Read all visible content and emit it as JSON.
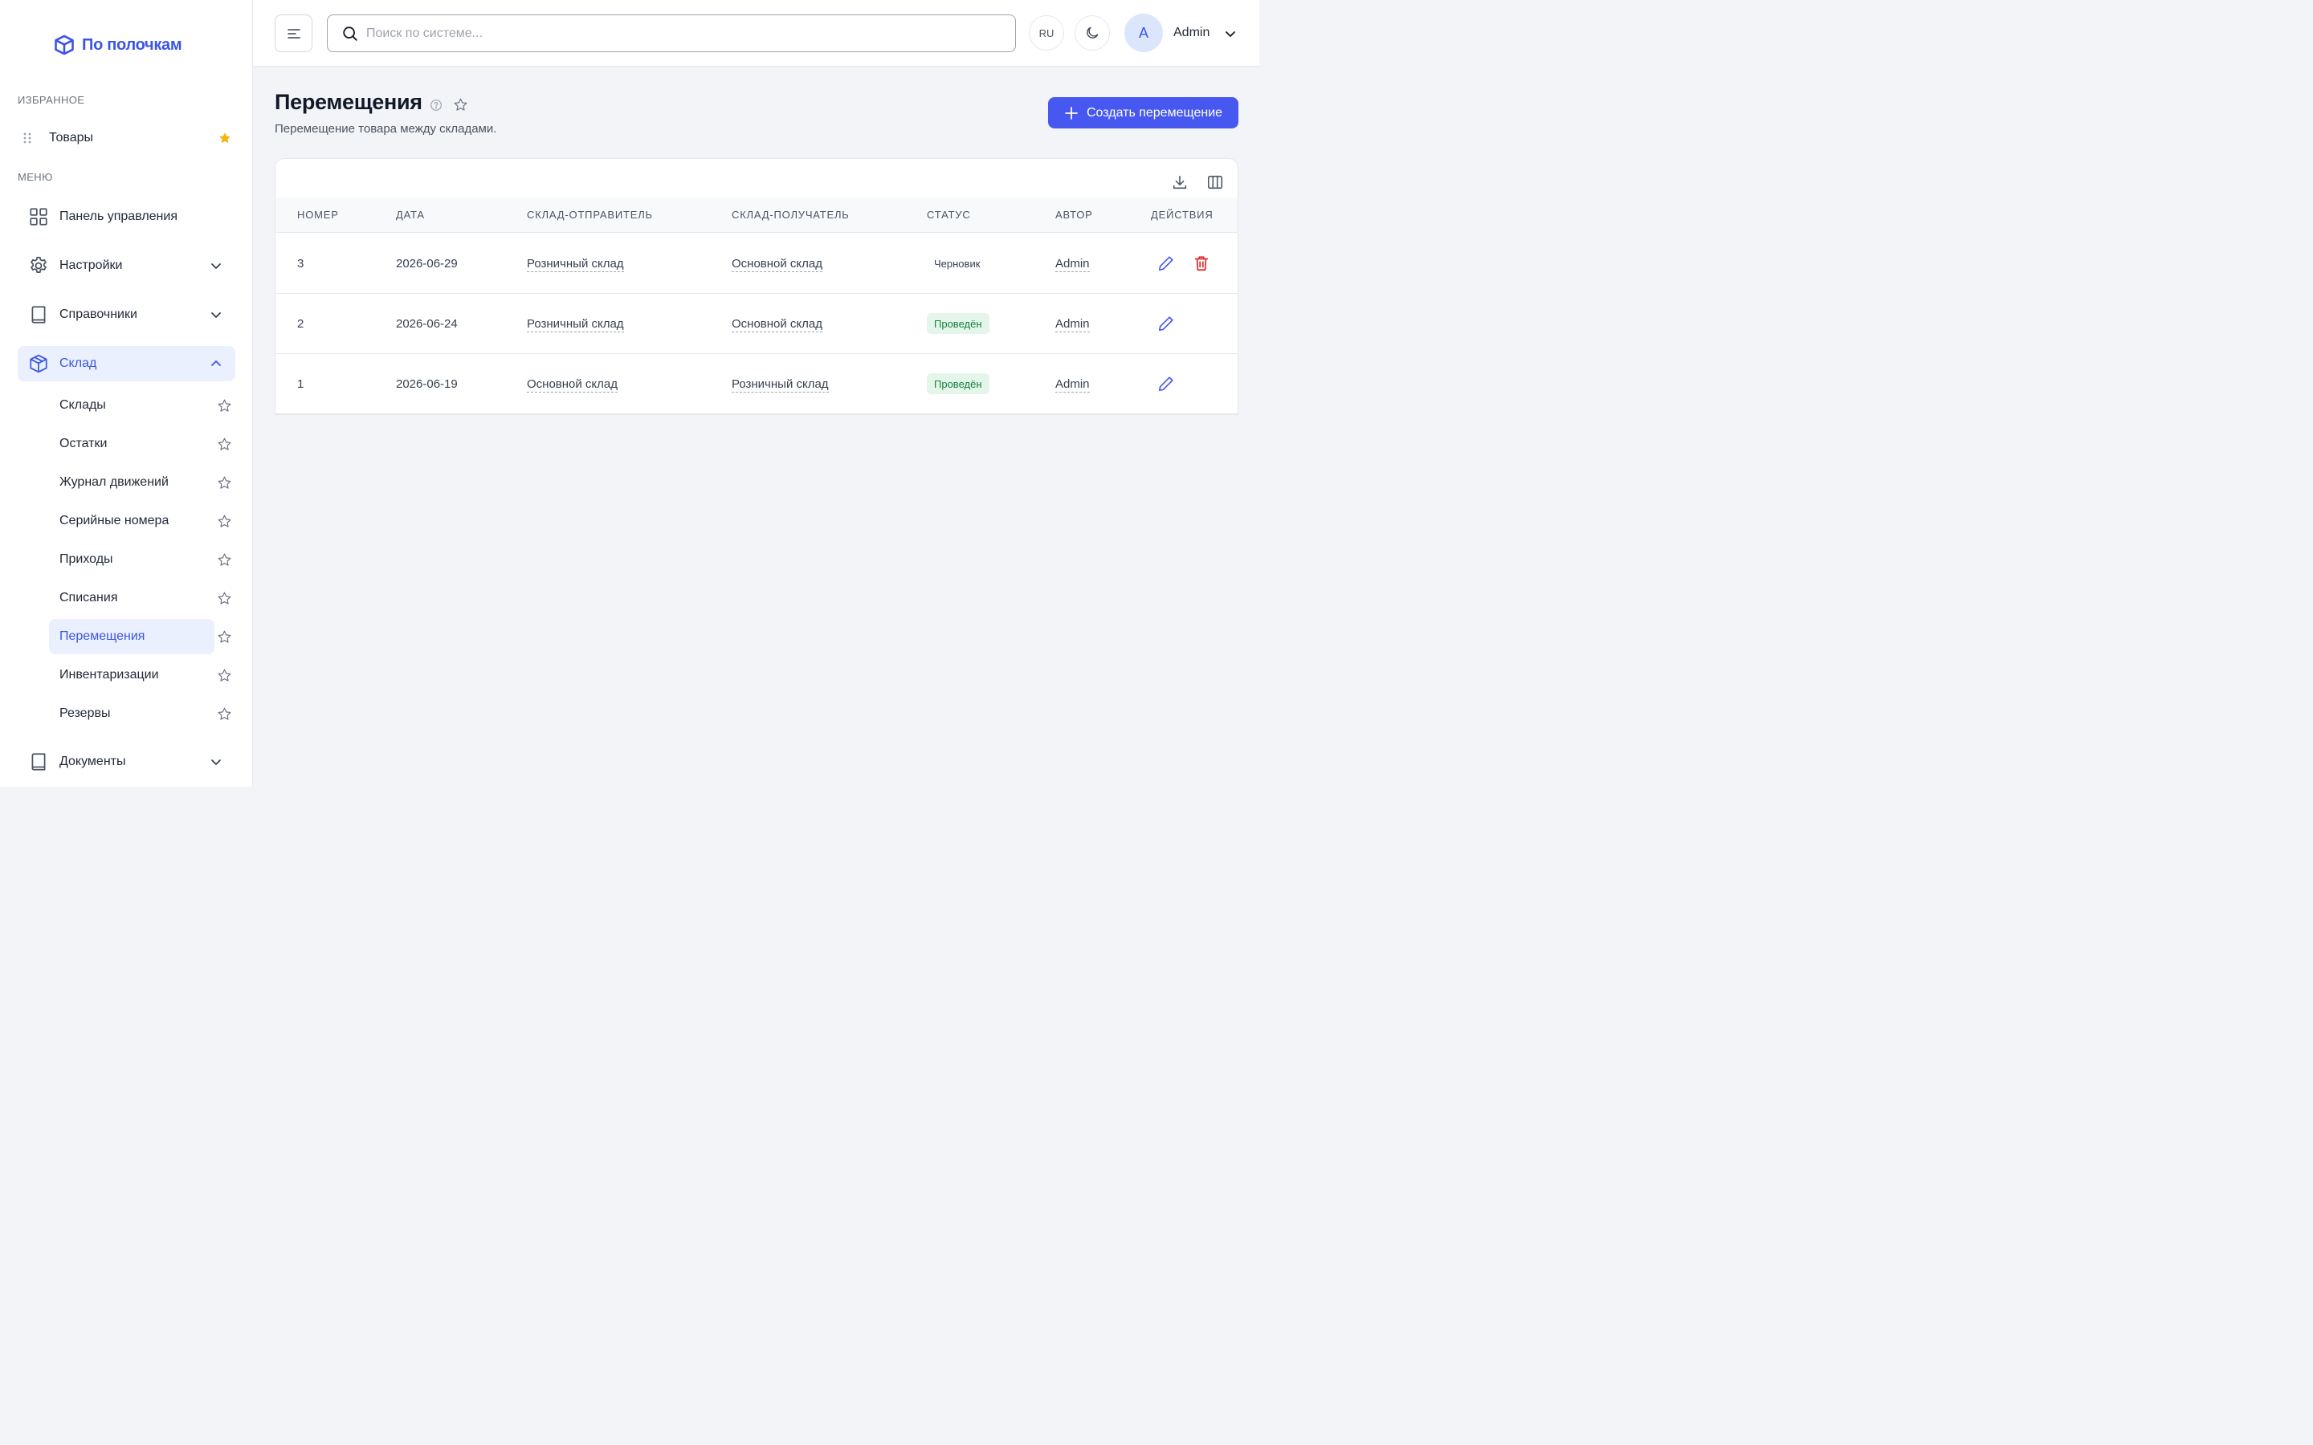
{
  "brand": {
    "name": "По полочкам",
    "color": "#3b55e6"
  },
  "sidebar": {
    "favorites_label": "ИЗБРАННОЕ",
    "favorites": [
      {
        "label": "Товары",
        "starred": true,
        "star_color": "#f5b50a"
      }
    ],
    "menu_label": "МЕНЮ",
    "menu": [
      {
        "label": "Панель управления",
        "icon": "grid-icon"
      },
      {
        "label": "Настройки",
        "icon": "gear-icon",
        "expandable": true
      },
      {
        "label": "Справочники",
        "icon": "book-icon",
        "expandable": true
      },
      {
        "label": "Склад",
        "icon": "box-icon",
        "expanded": true,
        "active": true
      },
      {
        "label": "Документы",
        "icon": "book-icon",
        "expandable": true
      }
    ],
    "warehouse_items": [
      {
        "label": "Склады"
      },
      {
        "label": "Остатки"
      },
      {
        "label": "Журнал движений"
      },
      {
        "label": "Серийные номера"
      },
      {
        "label": "Приходы"
      },
      {
        "label": "Списания"
      },
      {
        "label": "Перемещения",
        "active": true
      },
      {
        "label": "Инвентаризации"
      },
      {
        "label": "Резервы"
      }
    ]
  },
  "topbar": {
    "search_placeholder": "Поиск по системе...",
    "lang": "RU",
    "user_initial": "A",
    "user_name": "Admin"
  },
  "page": {
    "title": "Перемещения",
    "subtitle": "Перемещение товара между складами.",
    "create_label": "Создать перемещение"
  },
  "table": {
    "columns": [
      "НОМЕР",
      "ДАТА",
      "СКЛАД-ОТПРАВИТЕЛЬ",
      "СКЛАД-ПОЛУЧАТЕЛЬ",
      "СТАТУС",
      "АВТОР",
      "ДЕЙСТВИЯ"
    ],
    "rows": [
      {
        "number": "3",
        "date": "2026-06-29",
        "from": "Розничный склад",
        "to": "Основной склад",
        "status": "Черновик",
        "author": "Admin",
        "can_delete": true
      },
      {
        "number": "2",
        "date": "2026-06-24",
        "from": "Розничный склад",
        "to": "Основной склад",
        "status": "Проведён",
        "author": "Admin",
        "can_delete": false
      },
      {
        "number": "1",
        "date": "2026-06-19",
        "from": "Основной склад",
        "to": "Розничный склад",
        "status": "Проведён",
        "author": "Admin",
        "can_delete": false
      }
    ]
  },
  "colors": {
    "accent": "#4758f0",
    "danger": "#dc2626",
    "success": "#15803d"
  }
}
